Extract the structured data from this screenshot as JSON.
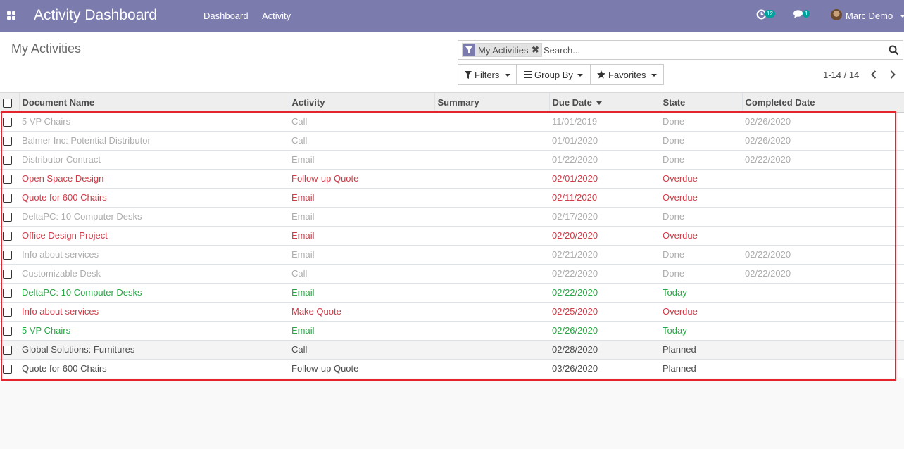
{
  "navbar": {
    "app_title": "Activity Dashboard",
    "menu": [
      "Dashboard",
      "Activity"
    ],
    "activity_count": "12",
    "message_count": "1",
    "user_name": "Marc Demo",
    "brand_color": "#7c7bad"
  },
  "control_panel": {
    "page_title": "My Activities",
    "search": {
      "facet_label": "My Activities",
      "placeholder": "Search..."
    },
    "buttons": {
      "filters": "Filters",
      "group_by": "Group By",
      "favorites": "Favorites"
    },
    "pager": "1-14 / 14"
  },
  "table": {
    "columns": [
      "Document Name",
      "Activity",
      "Summary",
      "Due Date",
      "State",
      "Completed Date"
    ],
    "sorted_column": "Due Date",
    "sort_direction": "descending",
    "rows": [
      {
        "document": "5 VP Chairs",
        "activity": "Call",
        "summary": "",
        "due": "11/01/2019",
        "state": "Done",
        "completed": "02/26/2020",
        "status": "done"
      },
      {
        "document": "Balmer Inc: Potential Distributor",
        "activity": "Call",
        "summary": "",
        "due": "01/01/2020",
        "state": "Done",
        "completed": "02/26/2020",
        "status": "done"
      },
      {
        "document": "Distributor Contract",
        "activity": "Email",
        "summary": "",
        "due": "01/22/2020",
        "state": "Done",
        "completed": "02/22/2020",
        "status": "done"
      },
      {
        "document": "Open Space Design",
        "activity": "Follow-up Quote",
        "summary": "",
        "due": "02/01/2020",
        "state": "Overdue",
        "completed": "",
        "status": "overdue"
      },
      {
        "document": "Quote for 600 Chairs",
        "activity": "Email",
        "summary": "",
        "due": "02/11/2020",
        "state": "Overdue",
        "completed": "",
        "status": "overdue"
      },
      {
        "document": "DeltaPC: 10 Computer Desks",
        "activity": "Email",
        "summary": "",
        "due": "02/17/2020",
        "state": "Done",
        "completed": "",
        "status": "done"
      },
      {
        "document": "Office Design Project",
        "activity": "Email",
        "summary": "",
        "due": "02/20/2020",
        "state": "Overdue",
        "completed": "",
        "status": "overdue"
      },
      {
        "document": "Info about services",
        "activity": "Email",
        "summary": "",
        "due": "02/21/2020",
        "state": "Done",
        "completed": "02/22/2020",
        "status": "done"
      },
      {
        "document": "Customizable Desk",
        "activity": "Call",
        "summary": "",
        "due": "02/22/2020",
        "state": "Done",
        "completed": "02/22/2020",
        "status": "done"
      },
      {
        "document": "DeltaPC: 10 Computer Desks",
        "activity": "Email",
        "summary": "",
        "due": "02/22/2020",
        "state": "Today",
        "completed": "",
        "status": "today"
      },
      {
        "document": "Info about services",
        "activity": "Make Quote",
        "summary": "",
        "due": "02/25/2020",
        "state": "Overdue",
        "completed": "",
        "status": "overdue"
      },
      {
        "document": "5 VP Chairs",
        "activity": "Email",
        "summary": "",
        "due": "02/26/2020",
        "state": "Today",
        "completed": "",
        "status": "today"
      },
      {
        "document": "Global Solutions: Furnitures",
        "activity": "Call",
        "summary": "",
        "due": "02/28/2020",
        "state": "Planned",
        "completed": "",
        "status": "planned"
      },
      {
        "document": "Quote for 600 Chairs",
        "activity": "Follow-up Quote",
        "summary": "",
        "due": "03/26/2020",
        "state": "Planned",
        "completed": "",
        "status": "planned"
      }
    ]
  },
  "colors": {
    "done": "#adadad",
    "overdue": "#cf3b47",
    "today": "#28a745",
    "planned": "#4c4c4c",
    "highlight": "#e5252d"
  }
}
